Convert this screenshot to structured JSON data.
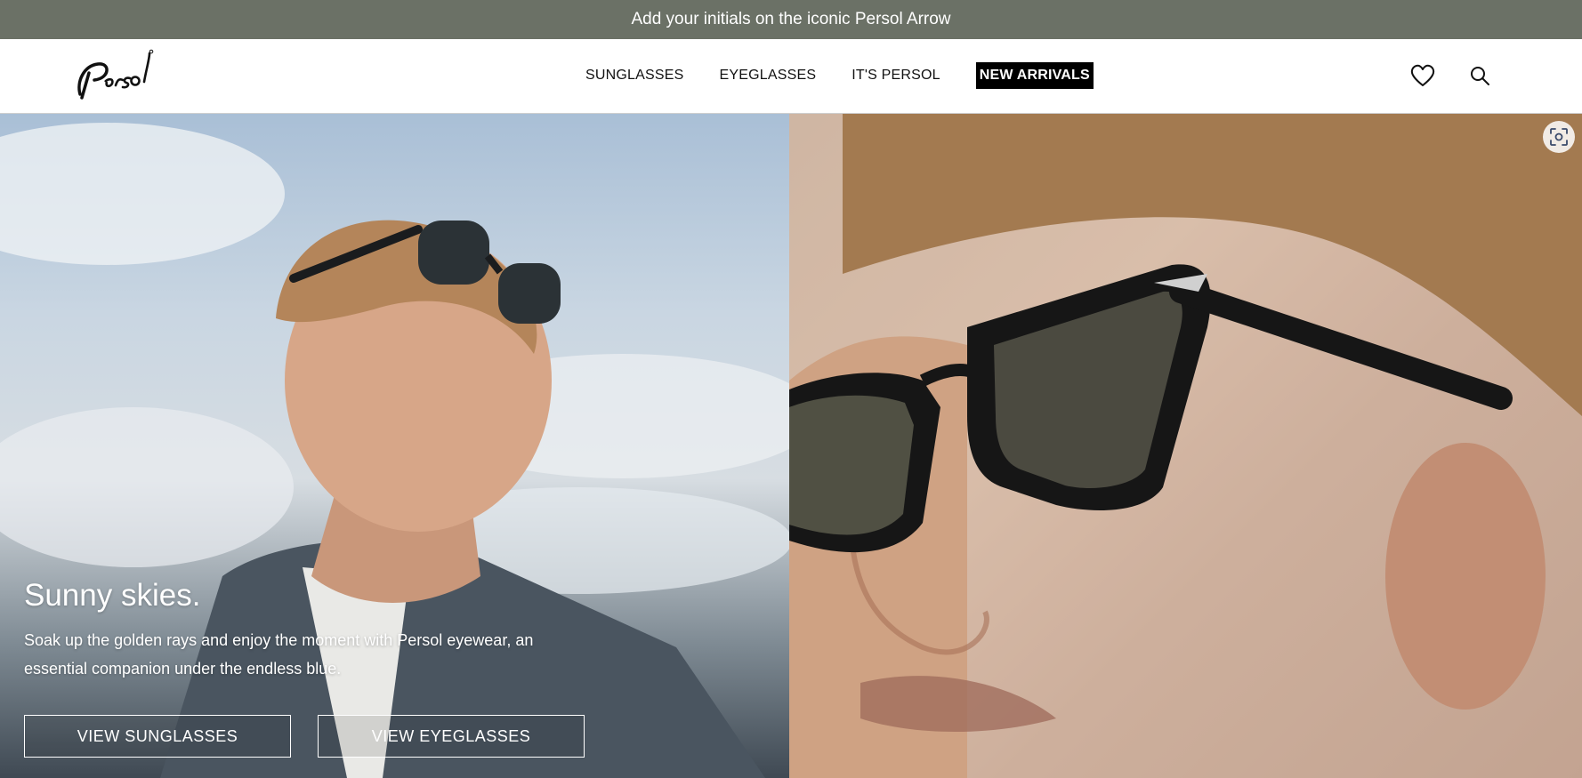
{
  "promo": {
    "text": "Add your initials on the iconic Persol Arrow"
  },
  "header": {
    "logo_text": "Persol",
    "nav": [
      {
        "label": "SUNGLASSES"
      },
      {
        "label": "EYEGLASSES"
      },
      {
        "label": "IT'S PERSOL"
      },
      {
        "label": "NEW ARRIVALS"
      }
    ],
    "icons": {
      "wishlist": "heart-icon",
      "search": "search-icon"
    }
  },
  "hero": {
    "title": "Sunny skies.",
    "description": "Soak up the golden rays and enjoy the moment with Persol eyewear, an essential companion under the endless blue.",
    "buttons": [
      {
        "label": "VIEW SUNGLASSES"
      },
      {
        "label": "VIEW EYEGLASSES"
      }
    ]
  },
  "colors": {
    "promo_bg": "#6b7166",
    "nav_highlight_bg": "#000000"
  }
}
